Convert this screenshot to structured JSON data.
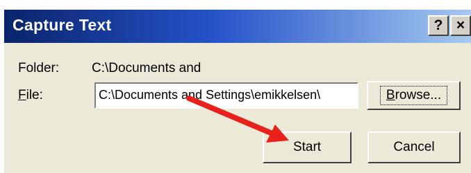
{
  "window": {
    "title": "Capture Text",
    "help_label": "?",
    "close_label": "×"
  },
  "form": {
    "folder_label": "Folder:",
    "folder_value": "C:\\Documents and",
    "file_label_first": "F",
    "file_label_rest": "ile:",
    "file_value": "C:\\Documents and Settings\\emikkelsen\\"
  },
  "buttons": {
    "browse_first": "B",
    "browse_rest": "rowse...",
    "start": "Start",
    "cancel": "Cancel"
  },
  "annotation": {
    "arrow_color": "#e8211a",
    "arrow_icon": "red-arrow-icon"
  }
}
